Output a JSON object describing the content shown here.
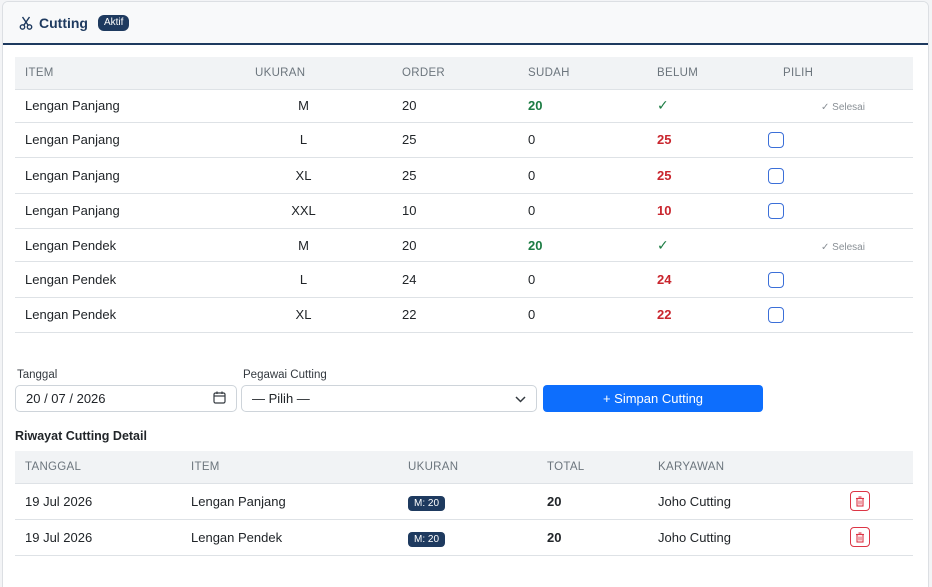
{
  "header": {
    "title": "Cutting",
    "badge": "Aktif",
    "icon": "scissors-icon"
  },
  "items_table": {
    "columns": [
      "ITEM",
      "UKURAN",
      "ORDER",
      "SUDAH",
      "BELUM",
      "PILIH"
    ],
    "rows": [
      {
        "item": "Lengan Panjang",
        "ukuran": "M",
        "order": "20",
        "sudah": "20",
        "belum": "✓",
        "done": true,
        "pilih": "✓ Selesai"
      },
      {
        "item": "Lengan Panjang",
        "ukuran": "L",
        "order": "25",
        "sudah": "0",
        "belum": "25",
        "done": false,
        "pilih": ""
      },
      {
        "item": "Lengan Panjang",
        "ukuran": "XL",
        "order": "25",
        "sudah": "0",
        "belum": "25",
        "done": false,
        "pilih": ""
      },
      {
        "item": "Lengan Panjang",
        "ukuran": "XXL",
        "order": "10",
        "sudah": "0",
        "belum": "10",
        "done": false,
        "pilih": ""
      },
      {
        "item": "Lengan Pendek",
        "ukuran": "M",
        "order": "20",
        "sudah": "20",
        "belum": "✓",
        "done": true,
        "pilih": "✓ Selesai"
      },
      {
        "item": "Lengan Pendek",
        "ukuran": "L",
        "order": "24",
        "sudah": "0",
        "belum": "24",
        "done": false,
        "pilih": ""
      },
      {
        "item": "Lengan Pendek",
        "ukuran": "XL",
        "order": "22",
        "sudah": "0",
        "belum": "22",
        "done": false,
        "pilih": ""
      }
    ]
  },
  "form": {
    "tanggal_label": "Tanggal",
    "tanggal_value": "20 / 07 / 2026",
    "pegawai_label": "Pegawai Cutting",
    "pegawai_value": "— Pilih —",
    "save_label": "+ Simpan Cutting"
  },
  "history": {
    "title": "Riwayat Cutting Detail",
    "columns": [
      "TANGGAL",
      "ITEM",
      "UKURAN",
      "TOTAL",
      "KARYAWAN"
    ],
    "rows": [
      {
        "tanggal": "19 Jul 2026",
        "item": "Lengan Panjang",
        "ukuran": "M: 20",
        "total": "20",
        "karyawan": "Joho Cutting"
      },
      {
        "tanggal": "19 Jul 2026",
        "item": "Lengan Pendek",
        "ukuran": "M: 20",
        "total": "20",
        "karyawan": "Joho Cutting"
      }
    ]
  },
  "colors": {
    "navy": "#1e3a5f",
    "primary": "#0d6efd",
    "green": "#1c7c43",
    "red": "#c9252d"
  }
}
